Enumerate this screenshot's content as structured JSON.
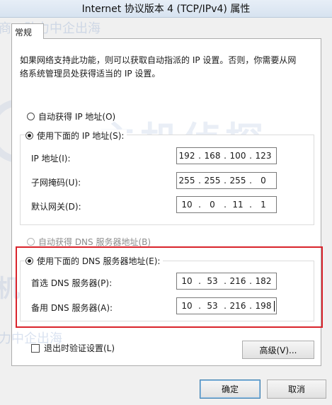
{
  "window": {
    "title": "Internet 协议版本 4 (TCP/IPv4) 属性"
  },
  "tab": {
    "label": "常规"
  },
  "description": {
    "line1": "如果网络支持此功能，则可以获取自动指派的 IP 设置。否则，你需要从网",
    "line2": "络系统管理员处获得适当的 IP 设置。"
  },
  "ip": {
    "auto_option": "自动获得 IP 地址(O)",
    "manual_option": "使用下面的 IP 地址(S):",
    "mode": "manual",
    "fields": [
      {
        "label": "IP 地址(I):",
        "octets": [
          "192",
          "168",
          "100",
          "123"
        ]
      },
      {
        "label": "子网掩码(U):",
        "octets": [
          "255",
          "255",
          "255",
          "0"
        ]
      },
      {
        "label": "默认网关(D):",
        "octets": [
          "10",
          "0",
          "11",
          "1"
        ]
      }
    ]
  },
  "dns": {
    "auto_option": "自动获得 DNS 服务器地址(B)",
    "manual_option": "使用下面的 DNS 服务器地址(E):",
    "mode": "manual",
    "fields": [
      {
        "label": "首选 DNS 服务器(P):",
        "octets": [
          "10",
          "53",
          "216",
          "182"
        ]
      },
      {
        "label": "备用 DNS 服务器(A):",
        "octets": [
          "10",
          "53",
          "216",
          "198"
        ]
      }
    ]
  },
  "validate": {
    "label": "退出时验证设置(L)",
    "checked": false
  },
  "buttons": {
    "advanced": "高级(V)...",
    "ok": "确定",
    "cancel": "取消"
  },
  "watermark": {
    "brand": "主机侦探",
    "slogan": "服务跨境电商助力中企出海",
    "fragment_top": "商，助力中企出海",
    "fragment_bottom": "力中企出海",
    "fragment_side": "机侦"
  },
  "colors": {
    "highlight": "#d9232b",
    "default_button_border": "#3c7fb1"
  }
}
